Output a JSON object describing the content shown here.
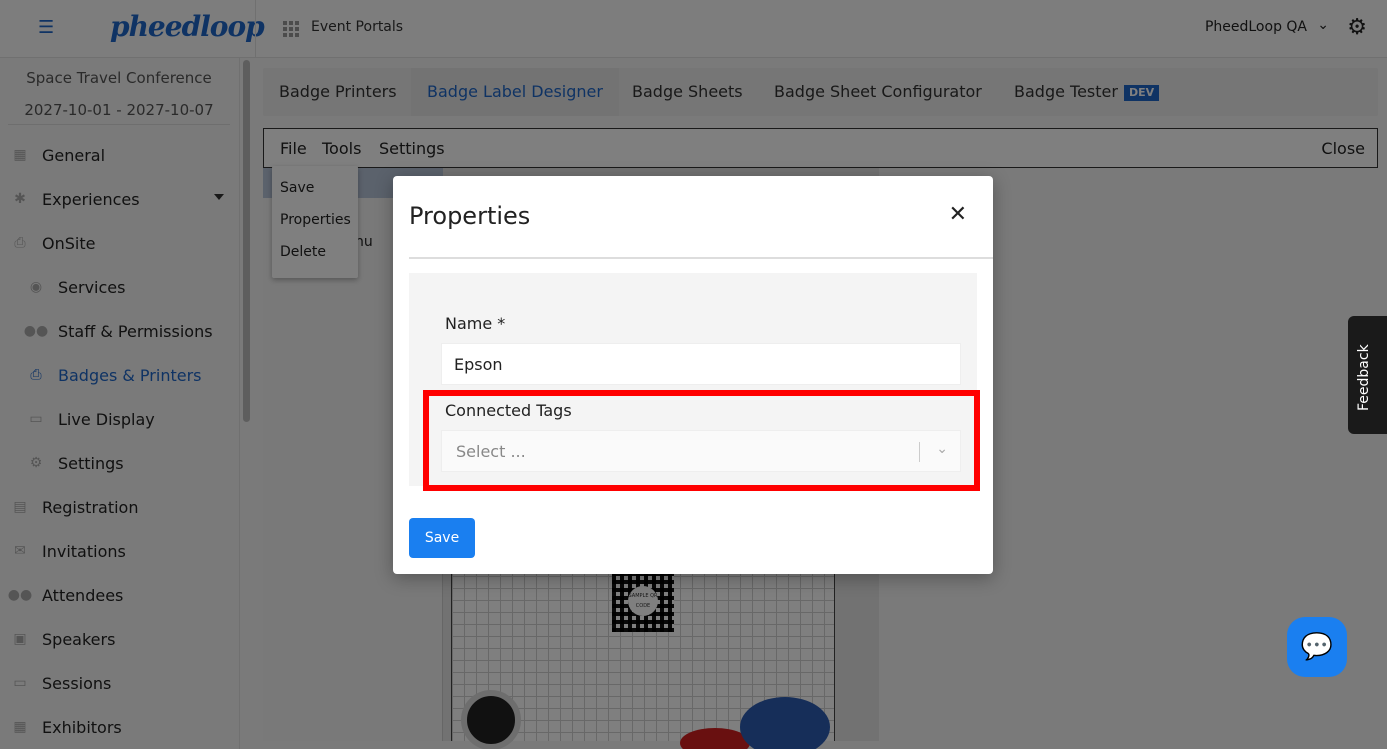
{
  "topbar": {
    "logo_text": "pheedloop",
    "portals_label": "Event Portals",
    "org_name": "PheedLoop QA"
  },
  "sidebar": {
    "event_name": "Space Travel Conference",
    "event_dates": "2027-10-01 - 2027-10-07",
    "items": [
      {
        "label": "General",
        "icon": "grid-icon"
      },
      {
        "label": "Experiences",
        "icon": "person-icon"
      },
      {
        "label": "OnSite",
        "icon": "printer-icon"
      },
      {
        "label": "Services",
        "icon": "palette-icon"
      },
      {
        "label": "Staff & Permissions",
        "icon": "people-icon"
      },
      {
        "label": "Badges & Printers",
        "icon": "printer-icon"
      },
      {
        "label": "Live Display",
        "icon": "monitor-icon"
      },
      {
        "label": "Settings",
        "icon": "gear-icon"
      },
      {
        "label": "Registration",
        "icon": "cart-icon"
      },
      {
        "label": "Invitations",
        "icon": "mail-icon"
      },
      {
        "label": "Attendees",
        "icon": "people-icon"
      },
      {
        "label": "Speakers",
        "icon": "podium-icon"
      },
      {
        "label": "Sessions",
        "icon": "laptop-icon"
      },
      {
        "label": "Exhibitors",
        "icon": "booth-icon"
      }
    ]
  },
  "tabs": [
    "Badge Printers",
    "Badge Label Designer",
    "Badge Sheets",
    "Badge Sheet Configurator",
    "Badge Tester"
  ],
  "dev_badge": "DEV",
  "menubar": {
    "file": "File",
    "tools": "Tools",
    "settings": "Settings",
    "close": "Close"
  },
  "context_menu": [
    "Save",
    "Properties",
    "Delete"
  ],
  "editor_partial_text": "nu",
  "qr_text": "SAMPLE QR CODE",
  "modal": {
    "title": "Properties",
    "name_label": "Name *",
    "name_value": "Epson",
    "tags_label": "Connected Tags",
    "tags_placeholder": "Select ...",
    "save_label": "Save"
  },
  "feedback_label": "Feedback",
  "colors": {
    "accent": "#1f66c8",
    "button": "#1a7ff0",
    "highlight": "#ff0000"
  }
}
